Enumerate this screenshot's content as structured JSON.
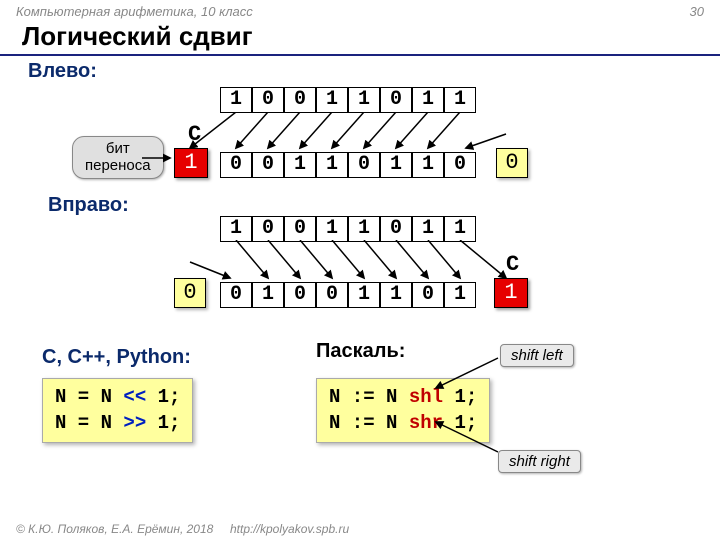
{
  "header": {
    "course": "Компьютерная арифметика, 10 класс",
    "page": "30"
  },
  "title": "Логический сдвиг",
  "left": {
    "label": "Влево:",
    "src": [
      "1",
      "0",
      "0",
      "1",
      "1",
      "0",
      "1",
      "1"
    ],
    "dst": [
      "0",
      "0",
      "1",
      "1",
      "0",
      "1",
      "1",
      "0"
    ],
    "carry_label": "C",
    "carry_bit": "1",
    "fill_bit": "0",
    "badge_l1": "бит",
    "badge_l2": "переноса"
  },
  "right": {
    "label": "Вправо:",
    "src": [
      "1",
      "0",
      "0",
      "1",
      "1",
      "0",
      "1",
      "1"
    ],
    "dst": [
      "0",
      "1",
      "0",
      "0",
      "1",
      "1",
      "0",
      "1"
    ],
    "carry_label": "C",
    "carry_bit": "1",
    "fill_bit": "0"
  },
  "code": {
    "c_label": "С, C++, Python:",
    "p_label": "Паскаль:",
    "c_l1a": "N = N ",
    "c_l1b": "<<",
    "c_l1c": " 1;",
    "c_l2a": "N = N ",
    "c_l2b": ">>",
    "c_l2c": " 1;",
    "p_l1a": "N := N ",
    "p_l1b": "shl",
    "p_l1c": " 1;",
    "p_l2a": "N := N ",
    "p_l2b": "shr",
    "p_l2c": " 1;",
    "annot_l": "shift left",
    "annot_r": "shift right"
  },
  "footer": {
    "copy": "© К.Ю. Поляков, Е.А. Ерёмин, 2018",
    "url": "http://kpolyakov.spb.ru"
  }
}
